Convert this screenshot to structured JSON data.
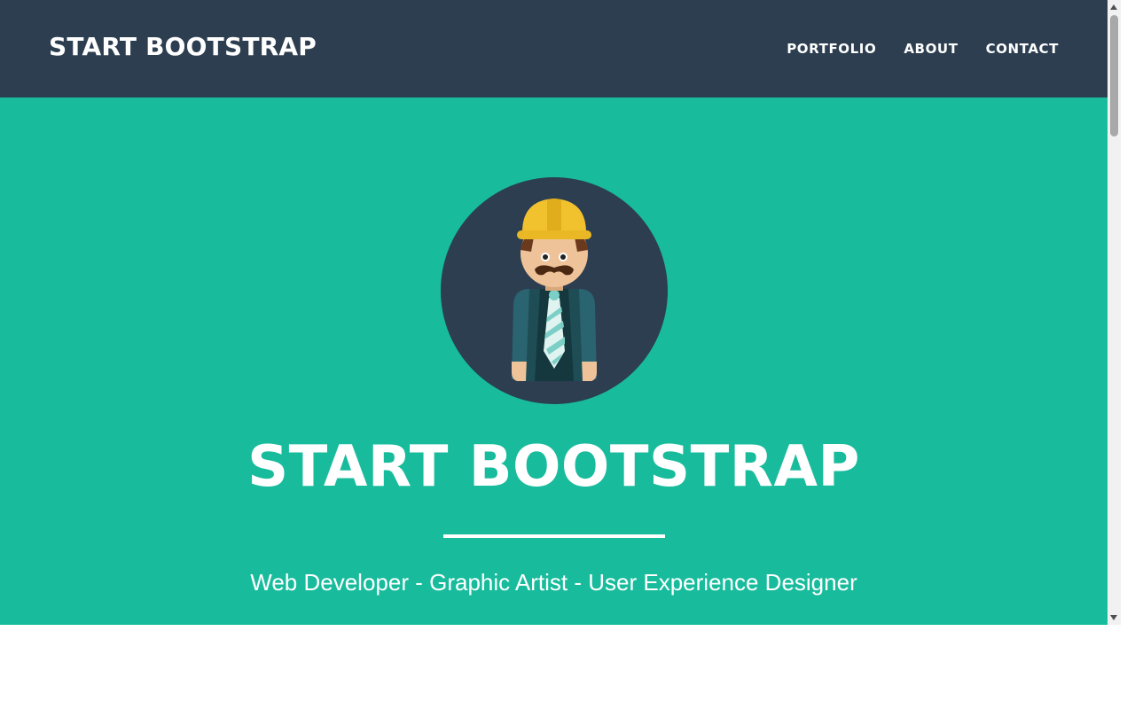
{
  "navbar": {
    "brand": "START BOOTSTRAP",
    "links": [
      {
        "label": "PORTFOLIO"
      },
      {
        "label": "ABOUT"
      },
      {
        "label": "CONTACT"
      }
    ]
  },
  "masthead": {
    "avatar_icon": "construction-worker-avatar-icon",
    "title": "START BOOTSTRAP",
    "subtitle": "Web Developer - Graphic Artist - User Experience Designer"
  },
  "colors": {
    "navbar": "#2c3e50",
    "masthead": "#18bc9c",
    "text": "#ffffff"
  }
}
